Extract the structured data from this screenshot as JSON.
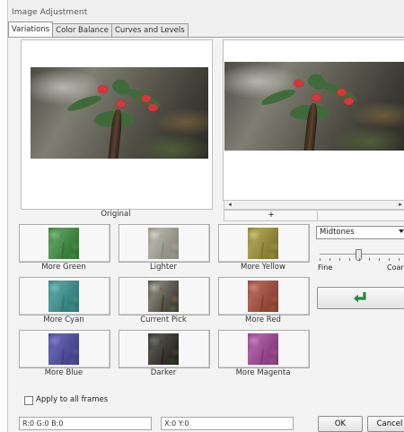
{
  "window": {
    "title": "Image Adjustment"
  },
  "tabs": [
    {
      "label": "Variations",
      "active": true
    },
    {
      "label": "Color Balance",
      "active": false
    },
    {
      "label": "Curves and Levels",
      "active": false
    }
  ],
  "original": {
    "caption": "Original"
  },
  "preview": {
    "scroll_left_icon": "◂",
    "scroll_right_icon": "▸",
    "zoom_icon": "+"
  },
  "variations": [
    {
      "label": "More Green",
      "tint": "rgba(40,190,60,0.45)"
    },
    {
      "label": "Lighter",
      "tint": "rgba(235,235,225,0.45)"
    },
    {
      "label": "More Yellow",
      "tint": "rgba(230,210,40,0.40)"
    },
    {
      "label": "More Cyan",
      "tint": "rgba(30,200,210,0.45)"
    },
    {
      "label": "Current Pick",
      "tint": "rgba(120,120,110,0.10)"
    },
    {
      "label": "More Red",
      "tint": "rgba(230,70,50,0.45)"
    },
    {
      "label": "More Blue",
      "tint": "rgba(70,70,230,0.50)"
    },
    {
      "label": "Darker",
      "tint": "rgba(10,10,10,0.40)"
    },
    {
      "label": "More Magenta",
      "tint": "rgba(220,60,220,0.45)"
    }
  ],
  "controls": {
    "tone_range": {
      "selected": "Midtones",
      "options": [
        "Midtones"
      ],
      "icon": "chevron-down-icon"
    },
    "slider": {
      "left_label": "Fine",
      "right_label": "Coarse",
      "value": 0.45
    },
    "reset_icon": "reset-arrow-icon"
  },
  "apply_all": {
    "label": "Apply to all frames",
    "checked": false
  },
  "status": {
    "rgb": "R:0 G:0 B:0",
    "xy": "X:0 Y:0"
  },
  "buttons": {
    "ok": "OK",
    "cancel": "Cancel"
  },
  "colors": {
    "reset_arrow": "#1f8f3a",
    "window_bg": "#f0f0f0"
  }
}
